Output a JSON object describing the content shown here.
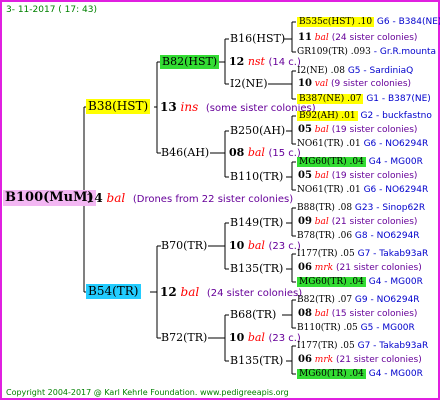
{
  "header": {
    "date": "3- 11-2017 ( 17: 43)"
  },
  "footer": {
    "copyright": "Copyright 2004-2017 @ Karl Kehrle Foundation.   www.pedigreeapis.org"
  },
  "gen1": {
    "label": "B100(MuM)",
    "year": "14",
    "mark": "bal",
    "note": "(Drones from 22 sister colonies)"
  },
  "gen2": [
    {
      "label": "B38(HST)",
      "year": "13",
      "mark": "ins",
      "note": "(some sister colonies)"
    },
    {
      "label": "B54(TR)",
      "year": "12",
      "mark": "bal",
      "note": "(24 sister colonies)"
    }
  ],
  "gen3": [
    {
      "label": "B82(HST)",
      "year": "12",
      "mark": "nst",
      "note": "(14 c.)"
    },
    {
      "label": "B46(AH)",
      "year": "08",
      "mark": "bal",
      "note": "(15 c.)"
    },
    {
      "label": "B70(TR)",
      "year": "10",
      "mark": "bal",
      "note": "(23 c.)"
    },
    {
      "label": "B72(TR)",
      "year": "10",
      "mark": "bal",
      "note": "(23 c.)"
    }
  ],
  "gen4": [
    {
      "label": "B16(HST)",
      "year": "11",
      "mark": "bal",
      "note": "(24 sister colonies)"
    },
    {
      "label": "I2(NE)",
      "year": "10",
      "mark": "val",
      "note": "(9 sister colonies)"
    },
    {
      "label": "B250(AH)",
      "year": "05",
      "mark": "bal",
      "note": "(19 sister colonies)"
    },
    {
      "label": "B110(TR)",
      "year": "05",
      "mark": "bal",
      "note": "(19 sister colonies)"
    },
    {
      "label": "B149(TR)",
      "year": "09",
      "mark": "bal",
      "note": "(21 sister colonies)"
    },
    {
      "label": "B135(TR)",
      "year": "06",
      "mark": "mrk",
      "note": "(21 sister colonies)"
    },
    {
      "label": "B68(TR)",
      "year": "08",
      "mark": "bal",
      "note": "(15 sister colonies)"
    },
    {
      "label": "B135(TR)",
      "year": "06",
      "mark": "mrk",
      "note": "(21 sister colonies)"
    }
  ],
  "gen5": [
    {
      "label": "B535c(HST) .10",
      "code": "G6 - B384(NE)"
    },
    {
      "label": "GR109(TR) .093",
      "code": "- Gr.R.mounta"
    },
    {
      "label": "I2(NE) .08",
      "code": "G5 - SardiniaQ"
    },
    {
      "label": "B387(NE) .07",
      "code": "G1 - B387(NE)"
    },
    {
      "label": "B92(AH) .01",
      "code": "G2 - buckfastno"
    },
    {
      "label": "NO61(TR) .01",
      "code": "G6 - NO6294R"
    },
    {
      "label": "MG60(TR) .04",
      "code": "G4 - MG00R"
    },
    {
      "label": "NO61(TR) .01",
      "code": "G6 - NO6294R"
    },
    {
      "label": "B88(TR) .08",
      "code": "G23 - Sinop62R"
    },
    {
      "label": "B78(TR) .06",
      "code": "G8 - NO6294R"
    },
    {
      "label": "I177(TR) .05",
      "code": "G7 - Takab93aR"
    },
    {
      "label": "MG60(TR) .04",
      "code": "G4 - MG00R"
    },
    {
      "label": "B82(TR) .07",
      "code": "G9 - NO6294R"
    },
    {
      "label": "B110(TR) .05",
      "code": "G5 - MG00R"
    },
    {
      "label": "I177(TR) .05",
      "code": "G7 - Takab93aR"
    },
    {
      "label": "MG60(TR) .04",
      "code": "G4 - MG00R"
    }
  ],
  "colors": {
    "frame": "#e020e0",
    "yellow": "#ffff00",
    "green": "#33dd33",
    "cyan": "#22ccff",
    "pink": "#f3b7f3",
    "mark": "#ff0000",
    "note": "#660099",
    "code": "#0000cc"
  }
}
